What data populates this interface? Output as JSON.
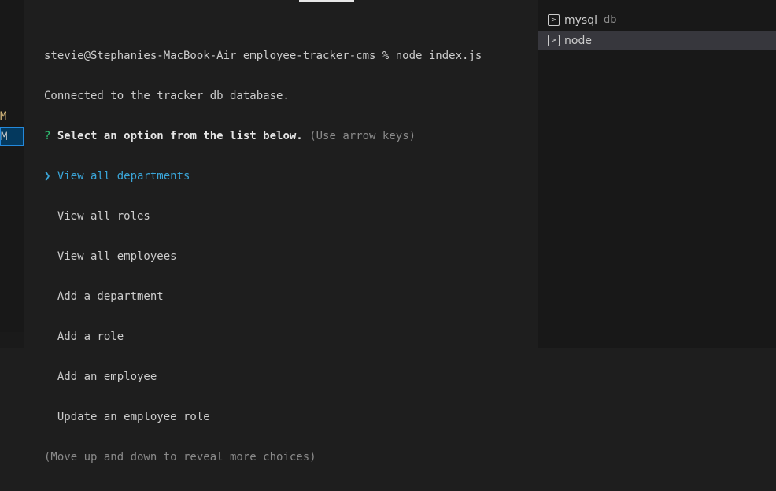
{
  "left": {
    "m1": "M",
    "m2": "M"
  },
  "terminal": {
    "prompt_line": "stevie@Stephanies-MacBook-Air employee-tracker-cms % node index.js",
    "connected": "Connected to the tracker_db database.",
    "question_mark": "?",
    "question": "Select an option from the list below.",
    "question_hint": "(Use arrow keys)",
    "caret": "❯",
    "options": [
      "View all departments",
      "View all roles",
      "View all employees",
      "Add a department",
      "Add a role",
      "Add an employee",
      "Update an employee role"
    ],
    "more_hint": "(Move up and down to reveal more choices)"
  },
  "terminals": [
    {
      "name": "mysql",
      "desc": "db",
      "icon": "terminal-icon"
    },
    {
      "name": "node",
      "desc": "",
      "icon": "terminal-icon"
    }
  ],
  "colors": {
    "background": "#1e1e1e",
    "selected_option": "#3aa5d8",
    "question_mark": "#2fbf71",
    "selection_bg": "#37373d"
  }
}
